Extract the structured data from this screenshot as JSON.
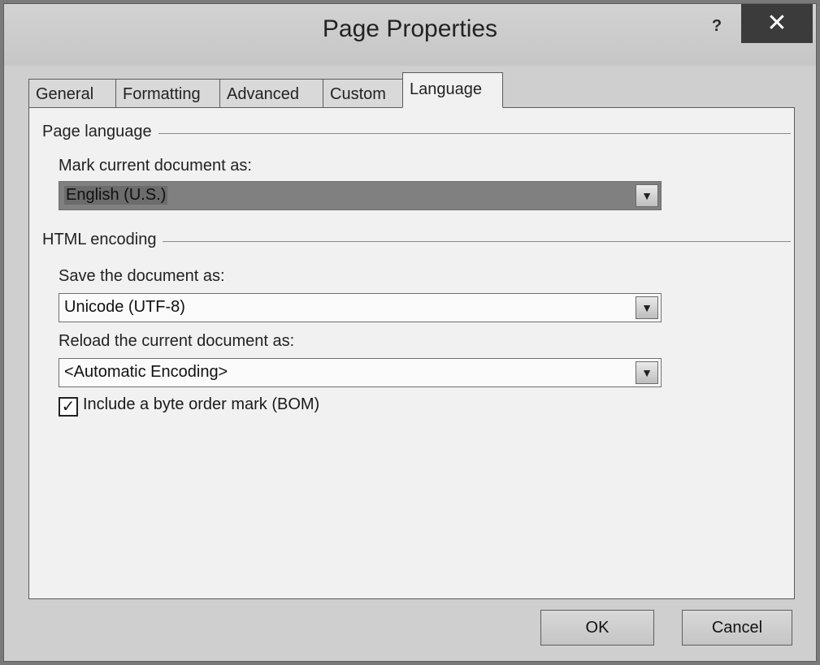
{
  "window": {
    "title": "Page Properties",
    "help_label": "?",
    "close_label": "✕"
  },
  "tabs": [
    {
      "label": "General",
      "active": false
    },
    {
      "label": "Formatting",
      "active": false
    },
    {
      "label": "Advanced",
      "active": false
    },
    {
      "label": "Custom",
      "active": false
    },
    {
      "label": "Language",
      "active": true
    }
  ],
  "page_language": {
    "group_title": "Page language",
    "mark_label": "Mark current document as:",
    "mark_value": "English (U.S.)"
  },
  "html_encoding": {
    "group_title": "HTML encoding",
    "save_label": "Save the document as:",
    "save_value": "Unicode (UTF-8)",
    "reload_label": "Reload the current document as:",
    "reload_value": "<Automatic Encoding>",
    "bom_label": "Include a byte order mark (BOM)",
    "bom_checked": true
  },
  "footer": {
    "ok_label": "OK",
    "cancel_label": "Cancel"
  },
  "icons": {
    "dropdown": "chevron-down-icon",
    "check": "checkmark-icon",
    "close": "close-icon",
    "help": "help-icon"
  }
}
